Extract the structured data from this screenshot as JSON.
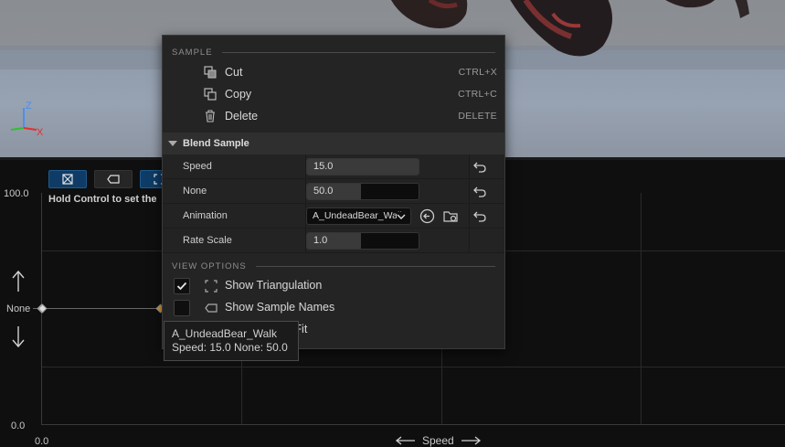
{
  "menu": {
    "sample_section": "SAMPLE",
    "items": [
      {
        "label": "Cut",
        "shortcut": "CTRL+X",
        "icon": "cut-icon"
      },
      {
        "label": "Copy",
        "shortcut": "CTRL+C",
        "icon": "copy-icon"
      },
      {
        "label": "Delete",
        "shortcut": "DELETE",
        "icon": "trash-icon"
      }
    ],
    "blend_sample": {
      "title": "Blend Sample",
      "speed_label": "Speed",
      "speed_value": "15.0",
      "none_label": "None",
      "none_value": "50.0",
      "animation_label": "Animation",
      "animation_value": "A_UndeadBear_Walk",
      "rate_scale_label": "Rate Scale",
      "rate_scale_value": "1.0"
    },
    "view_options_section": "VIEW OPTIONS",
    "show_triangulation": {
      "label": "Show Triangulation",
      "checked": true
    },
    "show_sample_names": {
      "label": "Show Sample Names",
      "checked": false
    },
    "partial_fit_label": "o Fit"
  },
  "tooltip": {
    "line1": "A_UndeadBear_Walk",
    "line2": "Speed: 15.0  None: 50.0"
  },
  "graph": {
    "hint": "Hold Control to set the",
    "y_max": "100.0",
    "y_min": "0.0",
    "x_min": "0.0",
    "y_axis_name": "None",
    "x_axis_name": "Speed"
  },
  "gizmo": {
    "z": "Z",
    "x": "X"
  },
  "colors": {
    "accent": "#0e3c66",
    "axis_x": "#e03030",
    "axis_y": "#30c030",
    "axis_z": "#4a8ff0"
  }
}
